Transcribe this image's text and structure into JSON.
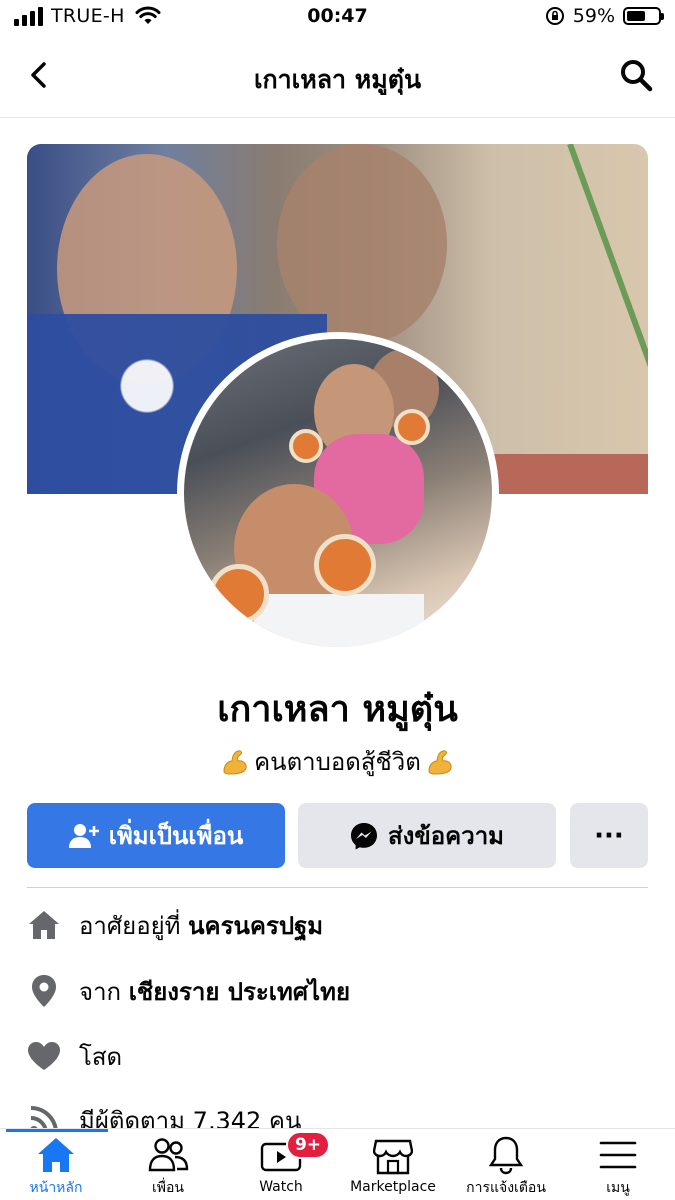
{
  "status_bar": {
    "carrier": "TRUE-H",
    "time": "00:47",
    "battery_percent": "59%",
    "battery_level": 0.59
  },
  "nav": {
    "title": "เกาเหลา หมูตุ๋น"
  },
  "profile": {
    "name": "เกาเหลา หมูตุ๋น",
    "bio": "คนตาบอดสู้ชีวิต"
  },
  "actions": {
    "add_friend": "เพิ่มเป็นเพื่อน",
    "message": "ส่งข้อความ",
    "more": "···"
  },
  "intro": {
    "lives_prefix": "อาศัยอยู่ที่",
    "lives_place": "นครนครปฐม",
    "from_prefix": "จาก",
    "from_place": "เชียงราย ประเทศไทย",
    "relationship": "โสด",
    "followers": "มีผู้ติดตาม 7,342 คน"
  },
  "tabs": {
    "home": "หน้าหลัก",
    "friends": "เพื่อน",
    "watch": "Watch",
    "watch_badge": "9+",
    "marketplace": "Marketplace",
    "notifications": "การแจ้งเตือน",
    "menu": "เมนู"
  },
  "colors": {
    "accent": "#1877f2",
    "primary_button": "#3578e5",
    "secondary_button": "#e4e6eb",
    "badge": "#e41e3f"
  }
}
